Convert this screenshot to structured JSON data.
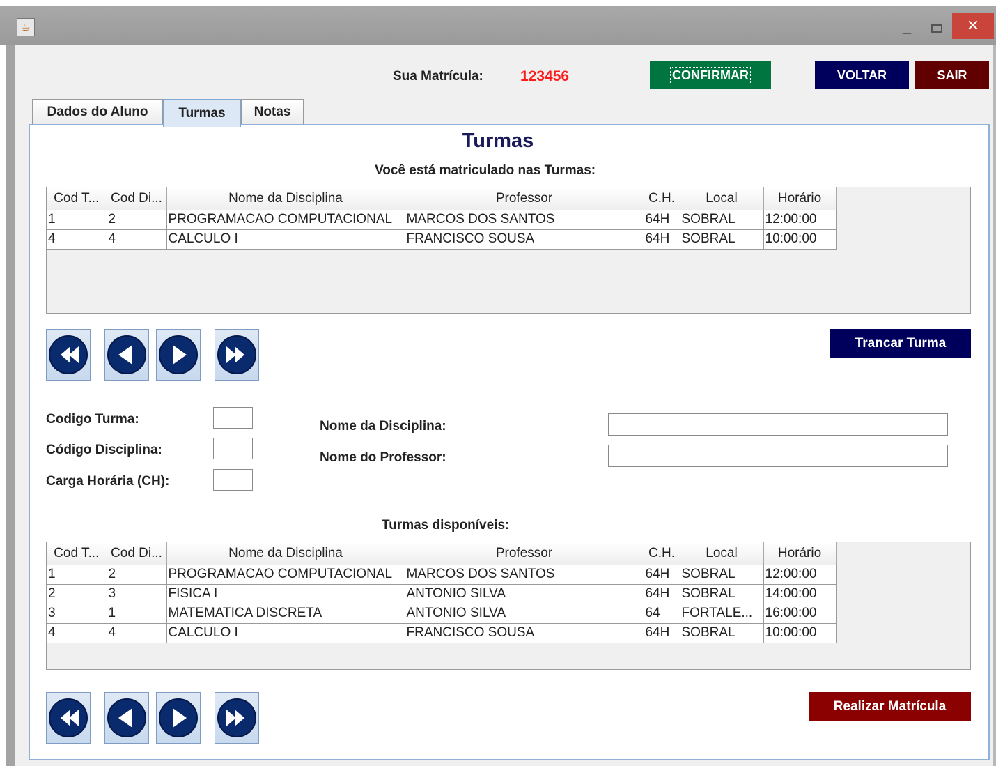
{
  "window": {
    "icon": "java-app-icon",
    "minimize": "_",
    "maximize": "",
    "close": "✕"
  },
  "header": {
    "matricula_label": "Sua Matrícula:",
    "matricula_value": "123456",
    "confirmar": "CONFIRMAR",
    "voltar": "VOLTAR",
    "sair": "SAIR"
  },
  "tabs": [
    {
      "label": "Dados do Aluno"
    },
    {
      "label": "Turmas",
      "selected": true
    },
    {
      "label": "Notas"
    }
  ],
  "turmas": {
    "title": "Turmas",
    "enrolled_heading": "Você está matriculado nas Turmas:",
    "available_heading": "Turmas disponíveis:",
    "trancar": "Trancar Turma",
    "realizar": "Realizar Matrícula",
    "columns": [
      "Cod T...",
      "Cod Di...",
      "Nome da Disciplina",
      "Professor",
      "C.H.",
      "Local",
      "Horário"
    ],
    "enrolled_rows": [
      [
        "1",
        "2",
        "PROGRAMACAO COMPUTACIONAL",
        "MARCOS DOS SANTOS",
        "64H",
        "SOBRAL",
        "12:00:00"
      ],
      [
        "4",
        "4",
        "CALCULO I",
        "FRANCISCO SOUSA",
        "64H",
        "SOBRAL",
        "10:00:00"
      ]
    ],
    "available_rows": [
      [
        "1",
        "2",
        "PROGRAMACAO COMPUTACIONAL",
        "MARCOS DOS SANTOS",
        "64H",
        "SOBRAL",
        "12:00:00"
      ],
      [
        "2",
        "3",
        "FISICA I",
        "ANTONIO SILVA",
        "64H",
        "SOBRAL",
        "14:00:00"
      ],
      [
        "3",
        "1",
        "MATEMATICA DISCRETA",
        "ANTONIO SILVA",
        "64",
        "FORTALE...",
        "16:00:00"
      ],
      [
        "4",
        "4",
        "CALCULO I",
        "FRANCISCO SOUSA",
        "64H",
        "SOBRAL",
        "10:00:00"
      ]
    ]
  },
  "form": {
    "codigo_turma_label": "Codigo Turma:",
    "codigo_disciplina_label": "Código Disciplina:",
    "carga_label": "Carga Horária (CH):",
    "nome_disciplina_label": "Nome da Disciplina:",
    "nome_professor_label": "Nome do Professor:",
    "codigo_turma_value": "",
    "codigo_disciplina_value": "",
    "carga_value": "",
    "nome_disciplina_value": "",
    "nome_professor_value": ""
  },
  "nav_icons": [
    "first-icon",
    "previous-icon",
    "next-icon",
    "last-icon"
  ],
  "colors": {
    "confirmar": "#007540",
    "voltar": "#00005c",
    "sair": "#600000",
    "trancar": "#00005c",
    "realizar": "#8b0000",
    "matricula_value": "#ff1a1a",
    "title": "#1a1a5a"
  }
}
